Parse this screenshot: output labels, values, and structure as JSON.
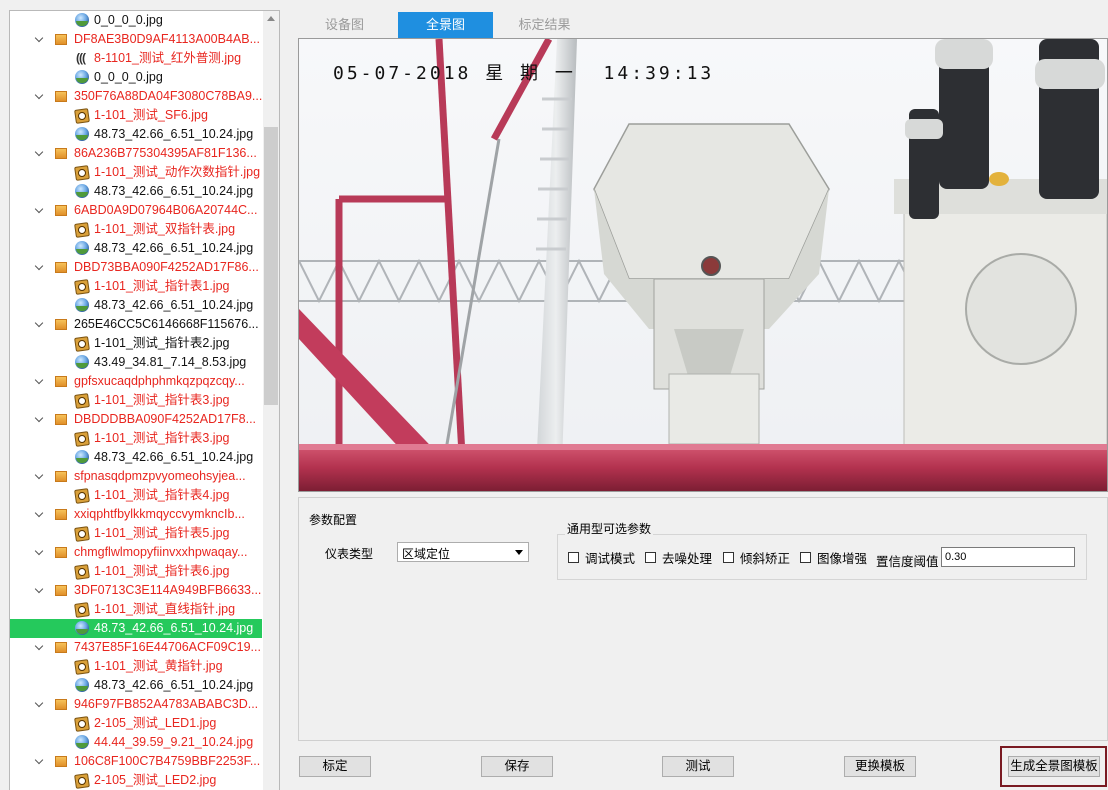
{
  "tree": {
    "items": [
      {
        "level": "file",
        "icon": "globe",
        "label": "0_0_0_0.jpg",
        "color": "black"
      },
      {
        "level": "group",
        "label": "DF8AE3B0D9AF4113A00B4AB...",
        "color": "red"
      },
      {
        "level": "file",
        "icon": "ir",
        "label": "8-1101_测试_红外普测.jpg",
        "color": "red"
      },
      {
        "level": "file",
        "icon": "globe",
        "label": "0_0_0_0.jpg",
        "color": "black"
      },
      {
        "level": "group",
        "label": "350F76A88DA04F3080C78BA9...",
        "color": "red"
      },
      {
        "level": "file",
        "icon": "meter",
        "label": "1-101_测试_SF6.jpg",
        "color": "red"
      },
      {
        "level": "file",
        "icon": "globe",
        "label": "48.73_42.66_6.51_10.24.jpg",
        "color": "black"
      },
      {
        "level": "group",
        "label": "86A236B775304395AF81F136...",
        "color": "red"
      },
      {
        "level": "file",
        "icon": "meter",
        "label": "1-101_测试_动作次数指针.jpg",
        "color": "red"
      },
      {
        "level": "file",
        "icon": "globe",
        "label": "48.73_42.66_6.51_10.24.jpg",
        "color": "black"
      },
      {
        "level": "group",
        "label": "6ABD0A9D07964B06A20744C...",
        "color": "red"
      },
      {
        "level": "file",
        "icon": "meter",
        "label": "1-101_测试_双指针表.jpg",
        "color": "red"
      },
      {
        "level": "file",
        "icon": "globe",
        "label": "48.73_42.66_6.51_10.24.jpg",
        "color": "black"
      },
      {
        "level": "group",
        "label": "DBD73BBA090F4252AD17F86...",
        "color": "red"
      },
      {
        "level": "file",
        "icon": "meter",
        "label": "1-101_测试_指针表1.jpg",
        "color": "red"
      },
      {
        "level": "file",
        "icon": "globe",
        "label": "48.73_42.66_6.51_10.24.jpg",
        "color": "black"
      },
      {
        "level": "group",
        "label": "265E46CC5C6146668F115676...",
        "color": "black"
      },
      {
        "level": "file",
        "icon": "meter",
        "label": "1-101_测试_指针表2.jpg",
        "color": "black"
      },
      {
        "level": "file",
        "icon": "globe",
        "label": "43.49_34.81_7.14_8.53.jpg",
        "color": "black"
      },
      {
        "level": "group",
        "label": "gpfsxucaqdphphmkqzpqzcqy...",
        "color": "red"
      },
      {
        "level": "file",
        "icon": "meter",
        "label": "1-101_测试_指针表3.jpg",
        "color": "red"
      },
      {
        "level": "group",
        "label": "DBDDDBBA090F4252AD17F8...",
        "color": "red"
      },
      {
        "level": "file",
        "icon": "meter",
        "label": "1-101_测试_指针表3.jpg",
        "color": "red"
      },
      {
        "level": "file",
        "icon": "globe",
        "label": "48.73_42.66_6.51_10.24.jpg",
        "color": "black"
      },
      {
        "level": "group",
        "label": "sfpnasqdpmzpvyomeohsyjea...",
        "color": "red"
      },
      {
        "level": "file",
        "icon": "meter",
        "label": "1-101_测试_指针表4.jpg",
        "color": "red"
      },
      {
        "level": "group",
        "label": "xxiqphtfbylkkmqyccvymkncIb...",
        "color": "red"
      },
      {
        "level": "file",
        "icon": "meter",
        "label": "1-101_测试_指针表5.jpg",
        "color": "red"
      },
      {
        "level": "group",
        "label": "chmgflwlmopyfiinvxxhpwaqay...",
        "color": "red"
      },
      {
        "level": "file",
        "icon": "meter",
        "label": "1-101_测试_指针表6.jpg",
        "color": "red"
      },
      {
        "level": "group",
        "label": "3DF0713C3E114A949BFB6633...",
        "color": "red"
      },
      {
        "level": "file",
        "icon": "meter",
        "label": "1-101_测试_直线指针.jpg",
        "color": "red"
      },
      {
        "level": "file",
        "icon": "globe",
        "label": "48.73_42.66_6.51_10.24.jpg",
        "color": "black",
        "selected": true
      },
      {
        "level": "group",
        "label": "7437E85F16E44706ACF09C19...",
        "color": "red"
      },
      {
        "level": "file",
        "icon": "meter",
        "label": "1-101_测试_黄指针.jpg",
        "color": "red"
      },
      {
        "level": "file",
        "icon": "globe",
        "label": "48.73_42.66_6.51_10.24.jpg",
        "color": "black"
      },
      {
        "level": "group",
        "label": "946F97FB852A4783ABABC3D...",
        "color": "red"
      },
      {
        "level": "file",
        "icon": "meter",
        "label": "2-105_测试_LED1.jpg",
        "color": "red"
      },
      {
        "level": "file",
        "icon": "globe",
        "label": "44.44_39.59_9.21_10.24.jpg",
        "color": "red"
      },
      {
        "level": "group",
        "label": "106C8F100C7B4759BBF2253F...",
        "color": "red"
      },
      {
        "level": "file",
        "icon": "meter",
        "label": "2-105_测试_LED2.jpg",
        "color": "red"
      }
    ]
  },
  "tabs": [
    {
      "label": "设备图",
      "active": false
    },
    {
      "label": "全景图",
      "active": true
    },
    {
      "label": "标定结果",
      "active": false
    }
  ],
  "photo": {
    "overlay_text": "05-07-2018 星 期 一  14:39:13"
  },
  "params": {
    "title": "参数配置",
    "meter_type_label": "仪表类型",
    "meter_type_value": "区域定位",
    "general": {
      "title": "通用型可选参数",
      "options": [
        "调试模式",
        "去噪处理",
        "倾斜矫正",
        "图像增强"
      ],
      "confidence_label": "置信度阈值",
      "confidence_value": "0.30"
    }
  },
  "buttons": {
    "calibrate": "标定",
    "save": "保存",
    "test": "测试",
    "replace_template": "更换模板",
    "generate_panorama_template": "生成全景图模板"
  },
  "colors": {
    "accent": "#1f8fe0",
    "selected_row": "#25c95c",
    "red_text": "#e8261f",
    "highlight_border": "#7a1a22"
  }
}
